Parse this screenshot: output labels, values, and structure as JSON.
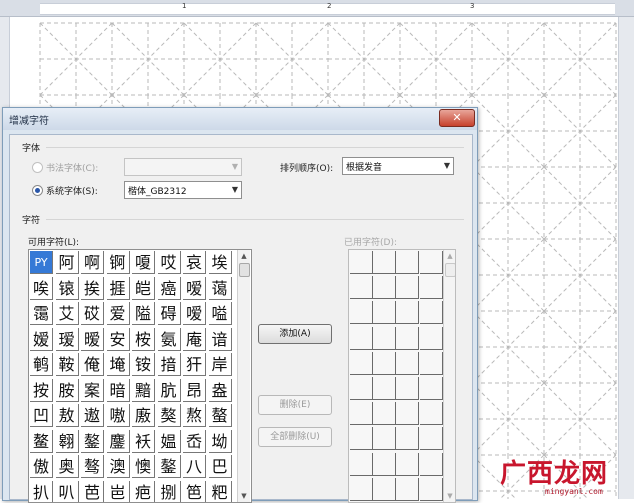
{
  "ruler": {
    "marks": [
      "1",
      "2",
      "3"
    ]
  },
  "dialog": {
    "title": "增减字符",
    "close_glyph": "✕",
    "font_group": {
      "label": "字体",
      "calligraphy_font": {
        "label": "书法字体(C):",
        "value": "",
        "checked": false,
        "enabled": false
      },
      "system_font": {
        "label": "系统字体(S):",
        "value": "楷体_GB2312",
        "checked": true,
        "enabled": true
      }
    },
    "sort_order": {
      "label": "排列顺序(O):",
      "value": "根据发音"
    },
    "char_group": {
      "label": "字符",
      "available_label": "可用字符(L):",
      "used_label": "已用字符(D):",
      "selected_char": "PY",
      "available_chars": [
        [
          "PY",
          "阿",
          "啊",
          "锕",
          "嗄",
          "哎",
          "哀",
          "埃"
        ],
        [
          "唉",
          "锿",
          "挨",
          "捱",
          "皑",
          "癌",
          "嗳",
          "蔼"
        ],
        [
          "霭",
          "艾",
          "砹",
          "爱",
          "隘",
          "碍",
          "嗳",
          "嗌"
        ],
        [
          "嫒",
          "瑷",
          "暧",
          "安",
          "桉",
          "氨",
          "庵",
          "谙"
        ],
        [
          "鹌",
          "鞍",
          "俺",
          "埯",
          "铵",
          "揞",
          "犴",
          "岸"
        ],
        [
          "按",
          "胺",
          "案",
          "暗",
          "黯",
          "肮",
          "昂",
          "盎"
        ],
        [
          "凹",
          "敖",
          "遨",
          "嗷",
          "廒",
          "獒",
          "熬",
          "螯"
        ],
        [
          "鳌",
          "翱",
          "鏊",
          "鏖",
          "袄",
          "媪",
          "岙",
          "坳"
        ],
        [
          "傲",
          "奥",
          "骜",
          "澳",
          "懊",
          "鏊",
          "八",
          "巴"
        ],
        [
          "扒",
          "叭",
          "芭",
          "岜",
          "疤",
          "捌",
          "笆",
          "粑"
        ]
      ]
    },
    "buttons": {
      "add": "添加(A)",
      "delete": "删除(E)",
      "delete_all": "全部删除(U)"
    }
  },
  "watermark": {
    "logo": "广西龙网",
    "url": "mingyanl.com"
  }
}
